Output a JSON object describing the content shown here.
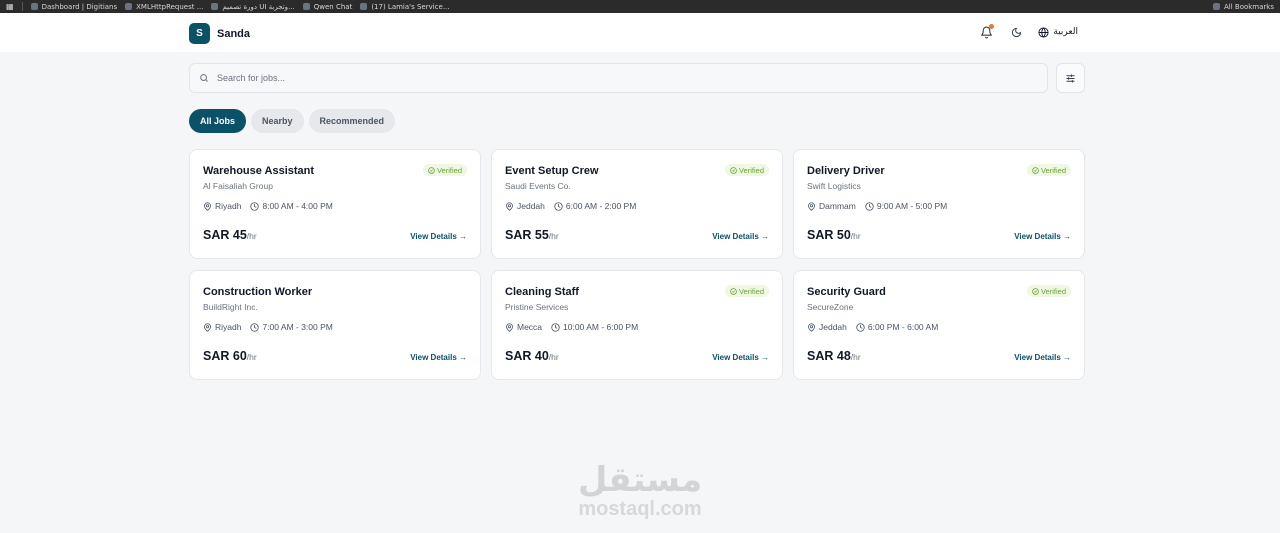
{
  "browser": {
    "bookmarks": [
      {
        "label": "Dashboard | Digitians"
      },
      {
        "label": "XMLHttpRequest ..."
      },
      {
        "label": "دورة تصميم UI وتجربة..."
      },
      {
        "label": "Qwen Chat"
      },
      {
        "label": "(17) Lamia's Service..."
      }
    ],
    "all_bookmarks": "All Bookmarks"
  },
  "header": {
    "logo_letter": "S",
    "brand": "Sanda",
    "language": "العربية"
  },
  "search": {
    "placeholder": "Search for jobs..."
  },
  "tabs": [
    {
      "label": "All Jobs",
      "active": true
    },
    {
      "label": "Nearby",
      "active": false
    },
    {
      "label": "Recommended",
      "active": false
    }
  ],
  "jobs": [
    {
      "title": "Warehouse Assistant",
      "company": "Al Faisaliah Group",
      "location": "Riyadh",
      "time": "8:00 AM - 4:00 PM",
      "price": "SAR 45",
      "unit": "/hr",
      "verified": "Verified",
      "action": "View Details →"
    },
    {
      "title": "Event Setup Crew",
      "company": "Saudi Events Co.",
      "location": "Jeddah",
      "time": "6:00 AM - 2:00 PM",
      "price": "SAR 55",
      "unit": "/hr",
      "verified": "Verified",
      "action": "View Details →"
    },
    {
      "title": "Delivery Driver",
      "company": "Swift Logistics",
      "location": "Dammam",
      "time": "9:00 AM - 5:00 PM",
      "price": "SAR 50",
      "unit": "/hr",
      "verified": "Verified",
      "action": "View Details →"
    },
    {
      "title": "Construction Worker",
      "company": "BuildRight Inc.",
      "location": "Riyadh",
      "time": "7:00 AM - 3:00 PM",
      "price": "SAR 60",
      "unit": "/hr",
      "verified": "",
      "action": "View Details →"
    },
    {
      "title": "Cleaning Staff",
      "company": "Pristine Services",
      "location": "Mecca",
      "time": "10:00 AM - 6:00 PM",
      "price": "SAR 40",
      "unit": "/hr",
      "verified": "Verified",
      "action": "View Details →"
    },
    {
      "title": "Security Guard",
      "company": "SecureZone",
      "location": "Jeddah",
      "time": "6:00 PM - 6:00 AM",
      "price": "SAR 48",
      "unit": "/hr",
      "verified": "Verified",
      "action": "View Details →"
    }
  ],
  "watermark": {
    "arabic": "مستقل",
    "latin": "mostaql.com"
  },
  "colors": {
    "brand": "#0b5168",
    "verified_bg": "#eef8e2",
    "verified_text": "#6aa336",
    "notification_dot": "#e07a3c"
  }
}
